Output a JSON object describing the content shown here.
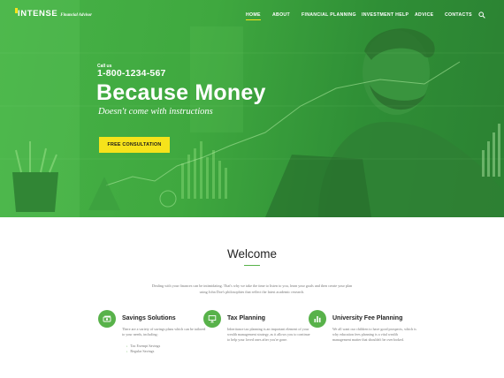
{
  "brand": {
    "name": "INTENSE",
    "tagline": "Financial Advisor",
    "accent": "#f6e31b",
    "green": "#58b24a"
  },
  "nav": {
    "items": [
      {
        "label": "HOME",
        "active": true
      },
      {
        "label": "ABOUT",
        "active": false
      },
      {
        "label": "FINANCIAL PLANNING",
        "active": false
      },
      {
        "label": "INVESTMENT HELP",
        "active": false
      },
      {
        "label": "ADVICE",
        "active": false
      },
      {
        "label": "CONTACTS",
        "active": false
      }
    ],
    "search_icon": "search-icon"
  },
  "hero": {
    "call_label": "Call us",
    "phone": "1-800-1234-567",
    "headline": "Because Money",
    "subline": "Doesn't come with instructions",
    "cta_label": "FREE CONSULTATION"
  },
  "welcome": {
    "title": "Welcome",
    "text": "Dealing with your finances can be intimidating. That's why we take the time to listen to you, learn your goals and then create your plan using John Doe's philosophies that reflect the latest academic research."
  },
  "features": [
    {
      "icon": "money-icon",
      "title": "Savings Solutions",
      "text": "There are a variety of savings plans which can be tailored to your needs, including:",
      "list": [
        "Tax Exempt Savings",
        "Regular Savings"
      ]
    },
    {
      "icon": "presentation-icon",
      "title": "Tax Planning",
      "text": "Inheritance tax planning is an important element of your wealth management strategy, as it allows you to continue to help your loved ones after you're gone.",
      "list": []
    },
    {
      "icon": "bar-chart-icon",
      "title": "University Fee Planning",
      "text": "We all want our children to have good prospects, which is why education fees planning is a vital wealth management matter that shouldn't be overlooked.",
      "list": []
    }
  ]
}
